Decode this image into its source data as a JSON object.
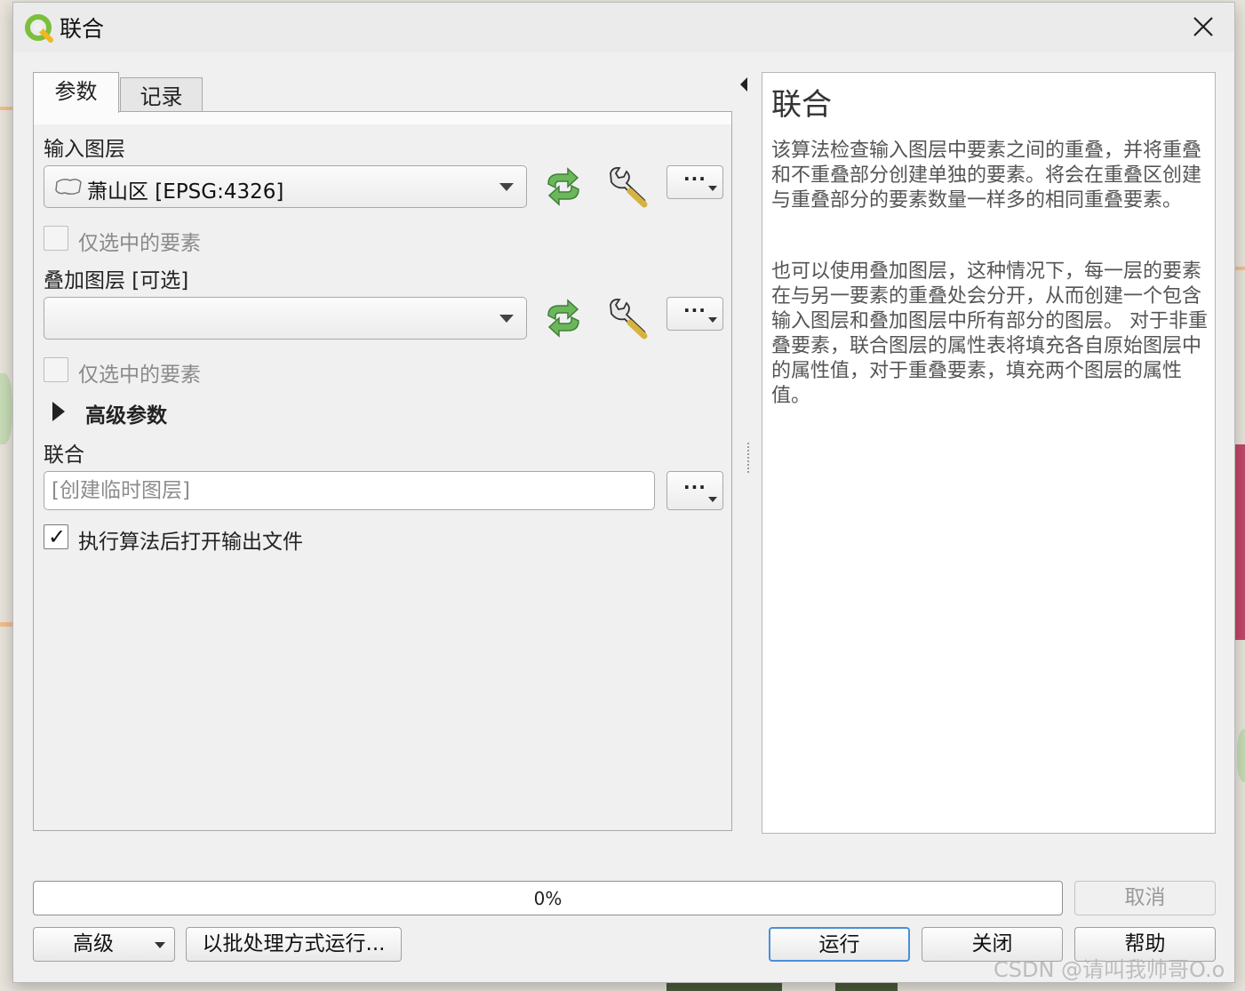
{
  "window": {
    "title": "联合"
  },
  "tabs": [
    {
      "label": "参数",
      "active": true
    },
    {
      "label": "记录",
      "active": false
    }
  ],
  "params": {
    "input_layer": {
      "label": "输入图层",
      "value": "萧山区 [EPSG:4326]",
      "selected_only_label": "仅选中的要素",
      "selected_only_checked": false
    },
    "overlay_layer": {
      "label": "叠加图层 [可选]",
      "value": "",
      "selected_only_label": "仅选中的要素",
      "selected_only_checked": false
    },
    "advanced_label": "高级参数",
    "output": {
      "label": "联合",
      "placeholder": "[创建临时图层]"
    },
    "open_output": {
      "label": "执行算法后打开输出文件",
      "checked": true
    },
    "dots": "···"
  },
  "help": {
    "title": "联合",
    "paragraphs": [
      "该算法检查输入图层中要素之间的重叠，并将重叠和不重叠部分创建单独的要素。将会在重叠区创建与重叠部分的要素数量一样多的相同重叠要素。",
      "也可以使用叠加图层，这种情况下，每一层的要素在与另一要素的重叠处会分开，从而创建一个包含输入图层和叠加图层中所有部分的图层。 对于非重叠要素，联合图层的属性表将填充各自原始图层中的属性值，对于重叠要素，填充两个图层的属性值。"
    ]
  },
  "progress": {
    "text": "0%",
    "value": 0
  },
  "buttons": {
    "cancel": "取消",
    "advanced": "高级",
    "batch": "以批处理方式运行...",
    "run": "运行",
    "close": "关闭",
    "help": "帮助"
  },
  "watermark": "CSDN @请叫我帅哥O.o",
  "colors": {
    "refresh_green": "#5aa84f",
    "wrench": "#c9a53a",
    "progress_fill": "#3d8ee6",
    "default_button_border": "#4a8fd9"
  }
}
